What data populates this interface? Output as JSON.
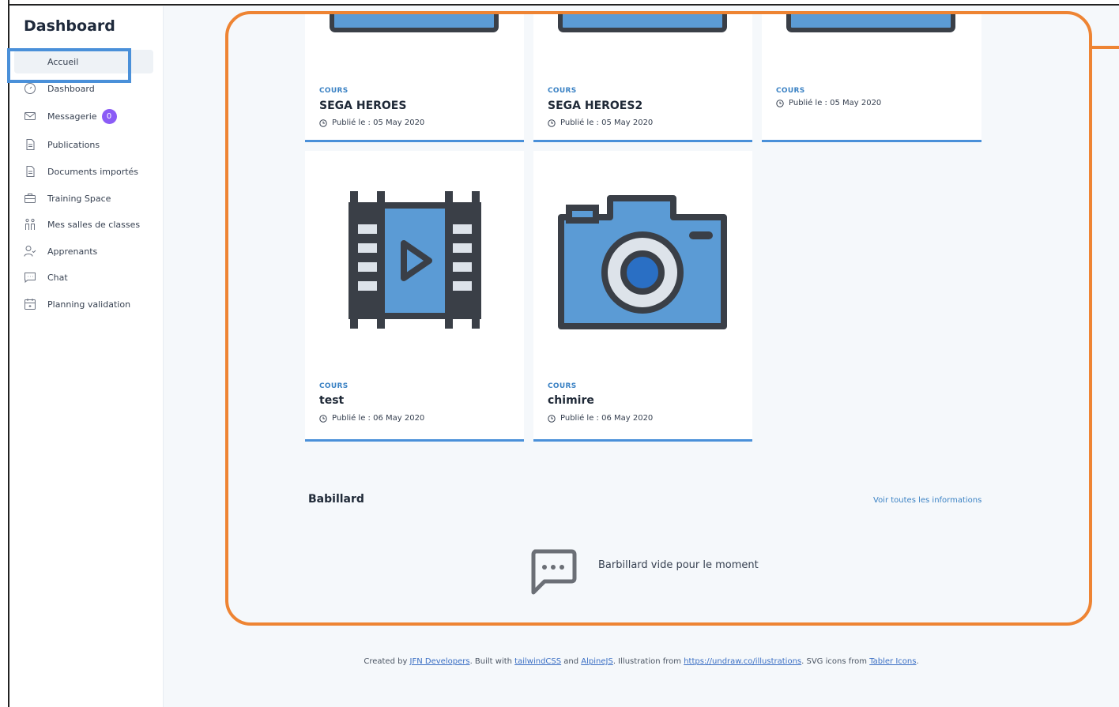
{
  "sidebar": {
    "title": "Dashboard",
    "items": [
      {
        "label": "Accueil",
        "icon": "home-icon"
      },
      {
        "label": "Dashboard",
        "icon": "gauge-icon"
      },
      {
        "label": "Messagerie",
        "icon": "mail-icon",
        "badge": "0"
      },
      {
        "label": "Publications",
        "icon": "file-icon"
      },
      {
        "label": "Documents importés",
        "icon": "file-text-icon"
      },
      {
        "label": "Training Space",
        "icon": "briefcase-icon"
      },
      {
        "label": "Mes salles de classes",
        "icon": "users-icon"
      },
      {
        "label": "Apprenants",
        "icon": "user-check-icon"
      },
      {
        "label": "Chat",
        "icon": "message-icon"
      },
      {
        "label": "Planning validation",
        "icon": "calendar-icon"
      }
    ]
  },
  "cards": [
    {
      "category": "COURS",
      "title": "SEGA HEROES",
      "published": "Publié le : 05 May 2020",
      "thumbnail": "monitor-icon"
    },
    {
      "category": "COURS",
      "title": "SEGA HEROES2",
      "published": "Publié le : 05 May 2020",
      "thumbnail": "monitor-icon"
    },
    {
      "category": "COURS",
      "title": "",
      "published": "Publié le : 05 May 2020",
      "thumbnail": "monitor-icon"
    },
    {
      "category": "COURS",
      "title": "test",
      "published": "Publié le : 06 May 2020",
      "thumbnail": "film-icon"
    },
    {
      "category": "COURS",
      "title": "chimire",
      "published": "Publié le : 06 May 2020",
      "thumbnail": "camera-icon"
    }
  ],
  "board": {
    "title": "Babillard",
    "link": "Voir toutes les informations",
    "empty_text": "Barbillard vide pour le moment"
  },
  "footer": {
    "t1": "Created by ",
    "l1": "JFN Developers",
    "t2": ". Built with ",
    "l2": "tailwindCSS",
    "t3": " and ",
    "l3": "AlpineJS",
    "t4": ". Illustration from ",
    "l4": "https://undraw.co/illustrations",
    "t5": ". SVG icons from ",
    "l5": "Tabler Icons",
    "t6": "."
  },
  "colors": {
    "accent": "#4a90d9",
    "highlight_orange": "#ee8433",
    "badge": "#8b5cf6",
    "icon_blue": "#5b9bd5",
    "icon_dark": "#3a3f47"
  }
}
